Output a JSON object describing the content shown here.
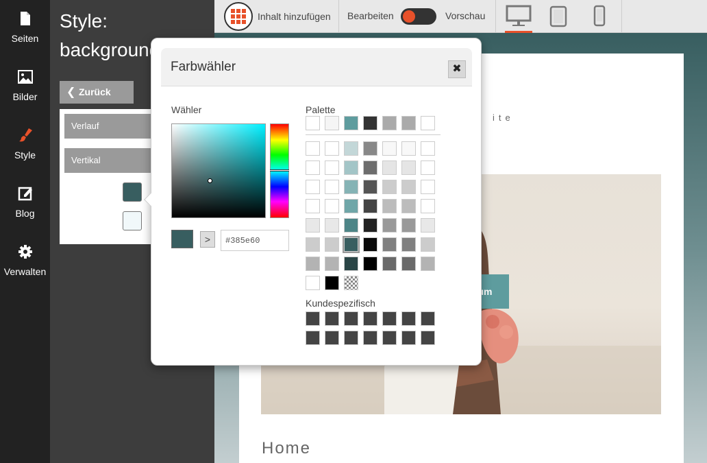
{
  "sidebar": {
    "items": [
      {
        "label": "Seiten",
        "icon": "page-icon"
      },
      {
        "label": "Bilder",
        "icon": "image-icon"
      },
      {
        "label": "Style",
        "icon": "brush-icon",
        "active": true
      },
      {
        "label": "Blog",
        "icon": "edit-icon"
      },
      {
        "label": "Verwalten",
        "icon": "gear-icon"
      }
    ]
  },
  "style_panel": {
    "title_line1": "Style:",
    "title_line2": "background",
    "back_label": "Zurück",
    "gradient_select": "Verlauf",
    "direction_select": "Vertikal",
    "color1": "#385e60",
    "color2": "#f1f8fa"
  },
  "toolbar": {
    "add_content_label": "Inhalt hinzufügen",
    "edit_label": "Bearbeiten",
    "preview_label": "Vorschau",
    "devices": [
      "desktop-icon",
      "tablet-icon",
      "phone-icon"
    ],
    "active_device": "desktop"
  },
  "preview": {
    "site_tag": "ite",
    "hero_button": "um",
    "home_heading": "Home"
  },
  "color_picker": {
    "title": "Farbwähler",
    "chooser_label": "Wähler",
    "palette_label": "Palette",
    "custom_label": "Kundespezifisch",
    "hex_value": "#385e60",
    "apply_label": ">",
    "palette_top": [
      "#ffffff",
      "#f5f5f5",
      "#5e9c9e",
      "#333333",
      "#aaaaaa",
      "#aaaaaa",
      "#ffffff"
    ],
    "palette_grid": [
      [
        "#ffffff",
        "#ffffff",
        "#c3d7d8",
        "#888888",
        "#f8f8f8",
        "#f8f8f8",
        "#ffffff"
      ],
      [
        "#ffffff",
        "#ffffff",
        "#a3c5c7",
        "#6d6d6d",
        "#e5e5e5",
        "#e5e5e5",
        "#ffffff"
      ],
      [
        "#ffffff",
        "#ffffff",
        "#85b3b5",
        "#555555",
        "#cccccc",
        "#cccccc",
        "#ffffff"
      ],
      [
        "#ffffff",
        "#ffffff",
        "#6fa6a8",
        "#444444",
        "#bcbcbc",
        "#bcbcbc",
        "#ffffff"
      ],
      [
        "#e8e8e8",
        "#e8e8e8",
        "#4d8587",
        "#222222",
        "#999999",
        "#999999",
        "#e8e8e8"
      ],
      [
        "#cccccc",
        "#cccccc",
        "#385e60",
        "#0a0a0a",
        "#808080",
        "#808080",
        "#cccccc"
      ],
      [
        "#b3b3b3",
        "#b3b3b3",
        "#2a4546",
        "#000000",
        "#6a6a6a",
        "#6a6a6a",
        "#b3b3b3"
      ]
    ],
    "palette_extra": [
      "#ffffff",
      "#000000",
      "transparent"
    ],
    "custom_colors": [
      [
        "#444444",
        "#444444",
        "#444444",
        "#444444",
        "#444444",
        "#444444",
        "#444444"
      ],
      [
        "#444444",
        "#444444",
        "#444444",
        "#444444",
        "#444444",
        "#444444",
        "#444444"
      ]
    ]
  }
}
